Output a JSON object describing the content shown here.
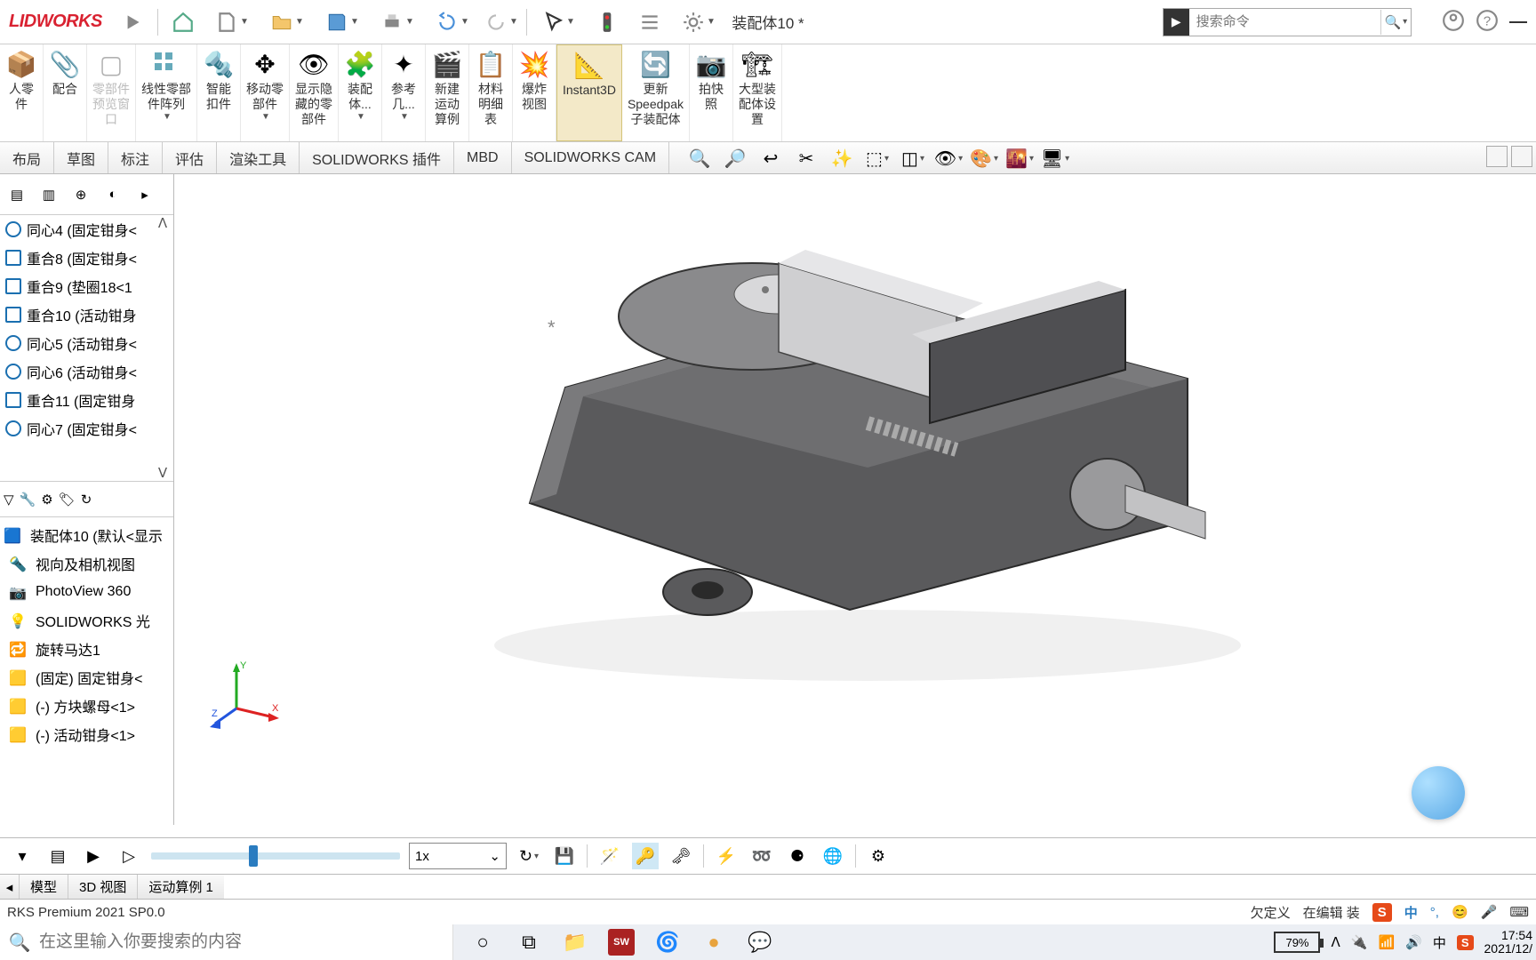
{
  "app": {
    "logo": "LIDWORKS"
  },
  "document": {
    "title": "装配体10 *"
  },
  "search": {
    "placeholder": "搜索命令"
  },
  "ribbon": [
    {
      "id": "insert",
      "label": "人零\n件"
    },
    {
      "id": "mate",
      "label": "配合"
    },
    {
      "id": "preview",
      "label": "零部件\n预览窗\n口",
      "disabled": true
    },
    {
      "id": "linear",
      "label": "线性零部\n件阵列"
    },
    {
      "id": "smart",
      "label": "智能\n扣件"
    },
    {
      "id": "move",
      "label": "移动零\n部件"
    },
    {
      "id": "showhide",
      "label": "显示隐\n藏的零\n部件"
    },
    {
      "id": "assyfeat",
      "label": "装配\n体..."
    },
    {
      "id": "refgeom",
      "label": "参考\n几..."
    },
    {
      "id": "newmotion",
      "label": "新建\n运动\n算例"
    },
    {
      "id": "bom",
      "label": "材料\n明细\n表"
    },
    {
      "id": "exploded",
      "label": "爆炸\n视图"
    },
    {
      "id": "instant3d",
      "label": "Instant3D",
      "highlighted": true
    },
    {
      "id": "speedpak",
      "label": "更新\nSpeedpak\n子装配体"
    },
    {
      "id": "snapshot",
      "label": "拍快\n照"
    },
    {
      "id": "largeassy",
      "label": "大型装\n配体设\n置"
    }
  ],
  "tabs": [
    "布局",
    "草图",
    "标注",
    "评估",
    "渲染工具",
    "SOLIDWORKS 插件",
    "MBD",
    "SOLIDWORKS CAM"
  ],
  "features": [
    "同心4 (固定钳身<",
    "重合8 (固定钳身<",
    "重合9 (垫圈18<1",
    "重合10 (活动钳身",
    "同心5 (活动钳身<",
    "同心6 (活动钳身<",
    "重合11 (固定钳身",
    "同心7 (固定钳身<"
  ],
  "tree": {
    "root": "装配体10  (默认<显示",
    "items": [
      "视向及相机视图",
      "PhotoView 360",
      "SOLIDWORKS 光",
      "旋转马达1",
      "(固定) 固定钳身<",
      "(-) 方块螺母<1>",
      "(-) 活动钳身<1>"
    ]
  },
  "motion": {
    "speed": "1x"
  },
  "bottom_tabs": [
    "模型",
    "3D 视图",
    "运动算例 1"
  ],
  "status": {
    "left": "RKS Premium 2021 SP0.0",
    "right1": "欠定义",
    "right2": "在编辑 装"
  },
  "taskbar": {
    "search_placeholder": "在这里输入你要搜索的内容",
    "battery": "79%",
    "time": "17:54",
    "date": "2021/12/"
  },
  "ime_badge": "中"
}
